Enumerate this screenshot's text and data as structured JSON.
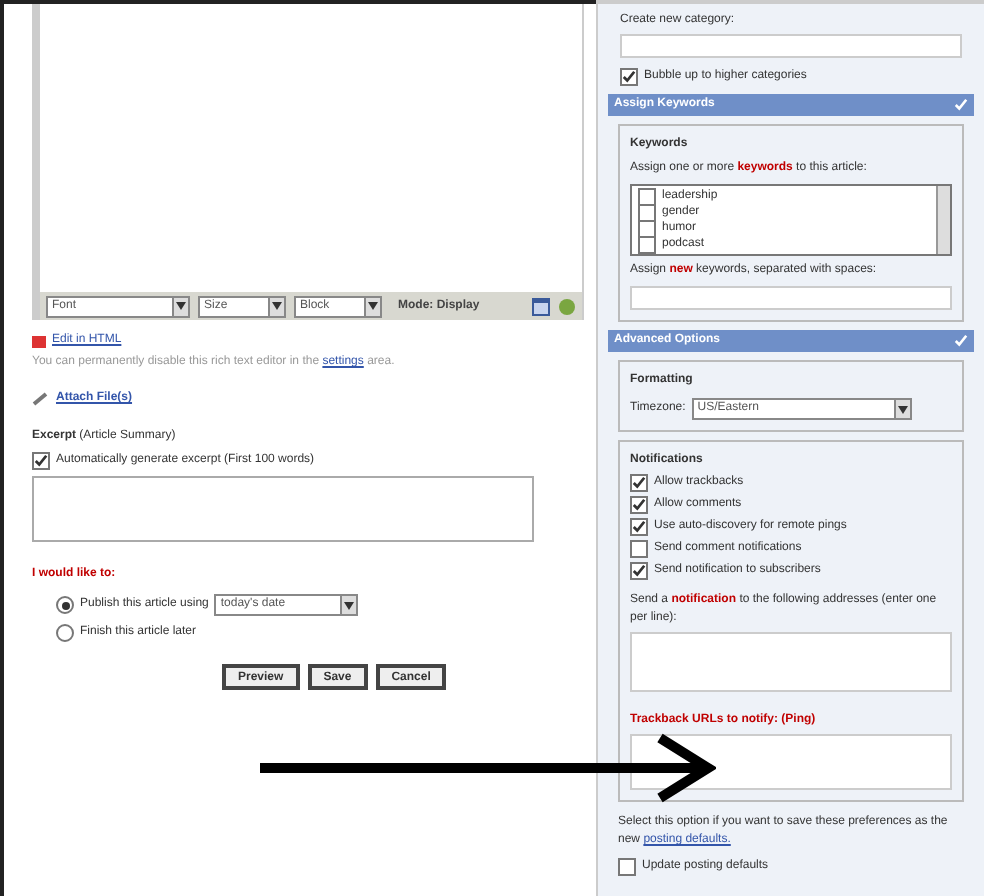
{
  "editor": {
    "selects": [
      "Font",
      "Size",
      "Block"
    ],
    "mode": "Mode: Display"
  },
  "html_toggle": {
    "label": "Edit in HTML",
    "note_start": "You can permanently disable this rich text editor in the",
    "note_link": "settings",
    "note_end": "area."
  },
  "attach": {
    "label": "Attach File(s)"
  },
  "excerpt": {
    "title": "**Excerpt** (Article Summary)",
    "auto": {
      "label": "Automatically generate excerpt (First 100 words)",
      "checked": true
    }
  },
  "publish": {
    "title": "I would like to:",
    "options": [
      {
        "label": "Publish this article using",
        "selected": true,
        "date": "today's date"
      },
      {
        "label": "Finish this article later",
        "selected": false
      }
    ]
  },
  "buttons": [
    "Preview",
    "Save",
    "Cancel"
  ],
  "categories": {
    "new_label": "Create new category:",
    "bubble": {
      "label": "Bubble up to higher categories",
      "checked": true
    }
  },
  "keywords_panel": {
    "title": "Assign Keywords",
    "legend": "Keywords",
    "prompt": "Assign one or more **keywords** to this article:",
    "items": [
      {
        "label": "leadership",
        "checked": false
      },
      {
        "label": "gender",
        "checked": false
      },
      {
        "label": "humor",
        "checked": false
      },
      {
        "label": "podcast",
        "checked": false
      }
    ],
    "new_prompt": "Assign **new** keywords, separated with spaces:"
  },
  "advanced_panel": {
    "title": "Advanced Options",
    "formatting": {
      "legend": "Formatting",
      "timezone_label": "Timezone:",
      "timezone": "US/Eastern"
    },
    "notifications": {
      "legend": "Notifications",
      "items": [
        {
          "label": "Allow trackbacks",
          "checked": true
        },
        {
          "label": "Allow comments",
          "checked": true
        },
        {
          "label": "Use auto-discovery for remote pings",
          "checked": true
        },
        {
          "label": "Send comment notifications",
          "checked": false
        },
        {
          "label": "Send notification to subscribers",
          "checked": true
        }
      ],
      "send_prompt": "Send a **notification** to the following addresses (enter one per line):",
      "trackback_label": "Trackback URLs to notify: (Ping)"
    },
    "defaults_note_start": "Select this option if you want to save these preferences as the new",
    "defaults_link": "posting defaults.",
    "update_defaults": {
      "label": "Update posting defaults",
      "checked": false
    }
  }
}
